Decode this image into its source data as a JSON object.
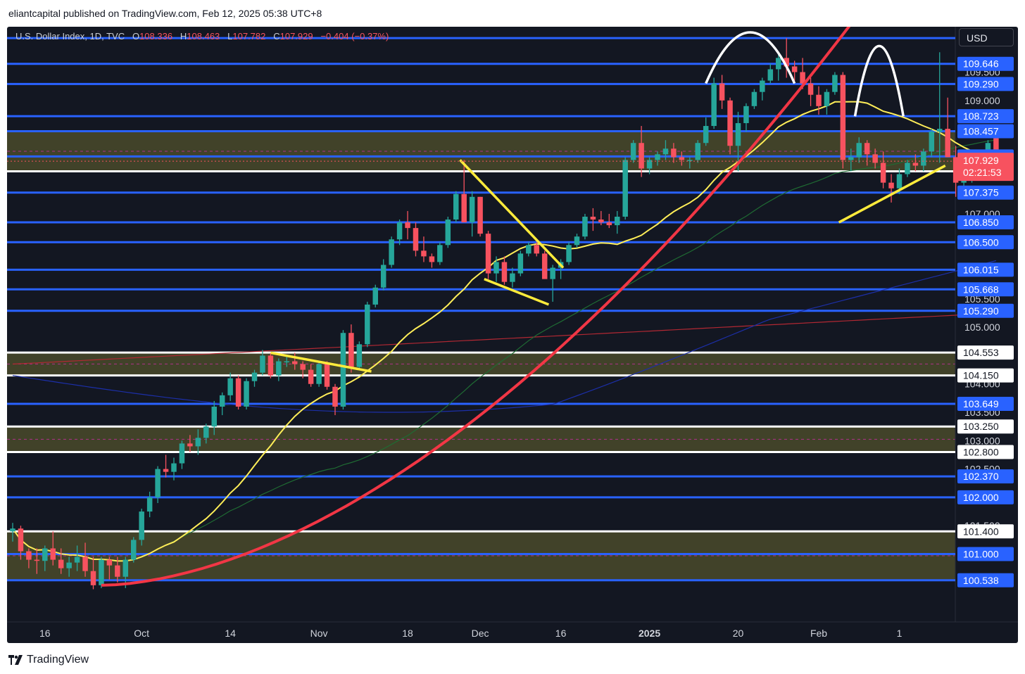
{
  "header": {
    "published_text": "eliantcapital published on TradingView.com, Feb 12, 2025 05:38 UTC+8"
  },
  "legend": {
    "symbol": "U.S. Dollar Index, 1D, TVC",
    "o_label": "O",
    "o_value": "108.336",
    "h_label": "H",
    "h_value": "108.463",
    "l_label": "L",
    "l_value": "107.782",
    "c_label": "C",
    "c_value": "107.929",
    "change": "−0.404 (−0.37%)"
  },
  "currency_button": "USD",
  "footer": {
    "brand": "TradingView"
  },
  "colors": {
    "background": "#131722",
    "up_candle": "#26a69a",
    "down_candle": "#f7525f",
    "level_blue": "#2962ff",
    "level_white": "#ffffff",
    "ma20": "#ffee58",
    "curve": "#f23645",
    "zone_fill": "#4a4a2a"
  },
  "chart_data": {
    "type": "candlestick",
    "symbol": "U.S. Dollar Index",
    "timeframe": "1D",
    "ylim": [
      100.2,
      110.3
    ],
    "x_ticks": [
      "16",
      "Oct",
      "14",
      "Nov",
      "18",
      "Dec",
      "16",
      "2025",
      "20",
      "Feb",
      "1"
    ],
    "y_ticks": [
      "109.500",
      "109.000",
      "107.000",
      "105.500",
      "105.000",
      "104.000",
      "103.500",
      "103.000",
      "102.500",
      "101.500"
    ],
    "tick_values": [
      109.5,
      109.0,
      107.0,
      105.5,
      105.0,
      104.0,
      103.5,
      103.0,
      102.5,
      101.5
    ],
    "x_tick_index": [
      4,
      16,
      27,
      38,
      49,
      58,
      68,
      79,
      90,
      100,
      110
    ],
    "price_levels": [
      {
        "value": 109.646,
        "label": "109.646",
        "color": "blue"
      },
      {
        "value": 109.29,
        "label": "109.290",
        "color": "blue"
      },
      {
        "value": 108.723,
        "label": "108.723",
        "color": "blue"
      },
      {
        "value": 108.457,
        "label": "108.457",
        "color": "blue"
      },
      {
        "value": 108.013,
        "label": "108.013",
        "color": "blue"
      },
      {
        "value": 107.75,
        "label": "107.750",
        "color": "white"
      },
      {
        "value": 107.375,
        "label": "107.375",
        "color": "blue"
      },
      {
        "value": 106.85,
        "label": "106.850",
        "color": "blue"
      },
      {
        "value": 106.5,
        "label": "106.500",
        "color": "blue"
      },
      {
        "value": 106.015,
        "label": "106.015",
        "color": "blue"
      },
      {
        "value": 105.668,
        "label": "105.668",
        "color": "blue"
      },
      {
        "value": 105.29,
        "label": "105.290",
        "color": "blue"
      },
      {
        "value": 104.553,
        "label": "104.553",
        "color": "white"
      },
      {
        "value": 104.15,
        "label": "104.150",
        "color": "white"
      },
      {
        "value": 103.649,
        "label": "103.649",
        "color": "blue"
      },
      {
        "value": 103.25,
        "label": "103.250",
        "color": "white"
      },
      {
        "value": 102.8,
        "label": "102.800",
        "color": "white"
      },
      {
        "value": 102.37,
        "label": "102.370",
        "color": "blue"
      },
      {
        "value": 102.0,
        "label": "102.000",
        "color": "blue"
      },
      {
        "value": 101.4,
        "label": "101.400",
        "color": "white"
      },
      {
        "value": 101.0,
        "label": "101.000",
        "color": "blue"
      },
      {
        "value": 100.538,
        "label": "100.538",
        "color": "blue"
      }
    ],
    "extra_lines": [
      110.1
    ],
    "zones": [
      [
        107.75,
        108.457
      ],
      [
        104.15,
        104.553
      ],
      [
        102.8,
        103.25
      ],
      [
        100.538,
        101.4
      ]
    ],
    "last_price": {
      "value": 107.929,
      "label": "107.929",
      "countdown": "02:21:53"
    },
    "ohlc": [
      [
        101.4,
        101.55,
        101.22,
        101.45
      ],
      [
        101.45,
        101.5,
        100.9,
        101.05
      ],
      [
        101.05,
        101.1,
        100.75,
        100.9
      ],
      [
        100.9,
        101.1,
        100.65,
        100.88
      ],
      [
        100.88,
        101.15,
        100.7,
        101.1
      ],
      [
        101.1,
        101.4,
        100.8,
        100.9
      ],
      [
        100.9,
        101.1,
        100.65,
        100.75
      ],
      [
        100.75,
        100.95,
        100.6,
        100.85
      ],
      [
        100.85,
        101.15,
        100.7,
        100.95
      ],
      [
        100.95,
        101.2,
        100.6,
        100.7
      ],
      [
        100.7,
        100.95,
        100.38,
        100.45
      ],
      [
        100.45,
        100.95,
        100.4,
        100.9
      ],
      [
        100.9,
        100.95,
        100.55,
        100.8
      ],
      [
        100.8,
        100.95,
        100.5,
        100.6
      ],
      [
        100.6,
        100.95,
        100.4,
        100.9
      ],
      [
        100.9,
        101.3,
        100.85,
        101.25
      ],
      [
        101.25,
        101.8,
        101.15,
        101.75
      ],
      [
        101.75,
        102.1,
        101.65,
        102.0
      ],
      [
        102.0,
        102.55,
        101.9,
        102.5
      ],
      [
        102.5,
        102.75,
        102.35,
        102.45
      ],
      [
        102.45,
        102.7,
        102.3,
        102.6
      ],
      [
        102.6,
        103.0,
        102.5,
        102.95
      ],
      [
        102.95,
        103.1,
        102.8,
        102.9
      ],
      [
        102.9,
        103.2,
        102.75,
        103.05
      ],
      [
        103.05,
        103.3,
        102.95,
        103.25
      ],
      [
        103.25,
        103.7,
        103.1,
        103.6
      ],
      [
        103.6,
        103.85,
        103.45,
        103.8
      ],
      [
        103.8,
        104.2,
        103.7,
        104.1
      ],
      [
        104.1,
        104.15,
        103.55,
        103.6
      ],
      [
        103.6,
        104.1,
        103.55,
        104.05
      ],
      [
        104.05,
        104.25,
        103.95,
        104.2
      ],
      [
        104.2,
        104.6,
        104.15,
        104.5
      ],
      [
        104.5,
        104.55,
        104.1,
        104.15
      ],
      [
        104.15,
        104.45,
        104.05,
        104.4
      ],
      [
        104.4,
        104.5,
        104.3,
        104.4
      ],
      [
        104.4,
        104.55,
        104.25,
        104.35
      ],
      [
        104.35,
        104.4,
        104.1,
        104.25
      ],
      [
        104.25,
        104.35,
        103.95,
        104.0
      ],
      [
        104.0,
        104.4,
        103.95,
        104.35
      ],
      [
        104.35,
        104.4,
        103.9,
        103.95
      ],
      [
        103.95,
        104.0,
        103.45,
        103.6
      ],
      [
        103.6,
        104.95,
        103.55,
        104.9
      ],
      [
        104.9,
        105.05,
        104.2,
        104.3
      ],
      [
        104.3,
        104.75,
        104.25,
        104.7
      ],
      [
        104.7,
        105.45,
        104.65,
        105.4
      ],
      [
        105.4,
        105.75,
        105.35,
        105.7
      ],
      [
        105.7,
        106.2,
        105.65,
        106.1
      ],
      [
        106.1,
        106.6,
        106.05,
        106.55
      ],
      [
        106.55,
        106.9,
        106.45,
        106.85
      ],
      [
        106.85,
        107.05,
        106.55,
        106.75
      ],
      [
        106.75,
        106.85,
        106.25,
        106.35
      ],
      [
        106.35,
        106.6,
        106.15,
        106.25
      ],
      [
        106.25,
        106.3,
        106.05,
        106.15
      ],
      [
        106.15,
        106.5,
        106.1,
        106.45
      ],
      [
        106.45,
        106.95,
        106.4,
        106.9
      ],
      [
        106.9,
        107.4,
        106.85,
        107.35
      ],
      [
        107.35,
        107.95,
        107.25,
        106.85
      ],
      [
        106.85,
        107.4,
        106.6,
        107.3
      ],
      [
        107.3,
        107.3,
        106.6,
        106.65
      ],
      [
        106.65,
        106.7,
        105.85,
        105.95
      ],
      [
        105.95,
        106.25,
        105.8,
        106.15
      ],
      [
        106.15,
        106.25,
        105.75,
        105.8
      ],
      [
        105.8,
        106.05,
        105.7,
        105.95
      ],
      [
        105.95,
        106.35,
        105.9,
        106.3
      ],
      [
        106.3,
        106.5,
        106.25,
        106.45
      ],
      [
        106.45,
        106.5,
        106.25,
        106.3
      ],
      [
        106.3,
        106.35,
        105.9,
        105.85
      ],
      [
        105.85,
        106.1,
        105.45,
        106.05
      ],
      [
        106.05,
        106.2,
        105.85,
        106.15
      ],
      [
        106.15,
        106.5,
        106.1,
        106.45
      ],
      [
        106.45,
        106.65,
        106.4,
        106.6
      ],
      [
        106.6,
        107.0,
        106.55,
        106.95
      ],
      [
        106.95,
        107.1,
        106.7,
        106.9
      ],
      [
        106.9,
        107.05,
        106.8,
        106.85
      ],
      [
        106.85,
        107.0,
        106.75,
        106.8
      ],
      [
        106.8,
        107.05,
        106.65,
        106.95
      ],
      [
        106.95,
        108.0,
        106.9,
        107.95
      ],
      [
        107.95,
        108.3,
        107.9,
        108.25
      ],
      [
        108.25,
        108.55,
        107.65,
        107.8
      ],
      [
        107.8,
        108.0,
        107.7,
        107.95
      ],
      [
        107.95,
        108.1,
        107.85,
        108.05
      ],
      [
        108.05,
        108.3,
        107.95,
        108.15
      ],
      [
        108.15,
        108.25,
        107.9,
        108.0
      ],
      [
        108.0,
        108.1,
        107.85,
        107.95
      ],
      [
        107.95,
        108.0,
        107.8,
        107.95
      ],
      [
        107.95,
        108.3,
        107.9,
        108.25
      ],
      [
        108.25,
        108.7,
        108.2,
        108.55
      ],
      [
        108.55,
        109.4,
        108.5,
        109.3
      ],
      [
        109.3,
        109.45,
        108.85,
        109.0
      ],
      [
        109.0,
        109.05,
        108.05,
        108.2
      ],
      [
        108.2,
        108.8,
        107.75,
        108.6
      ],
      [
        108.6,
        108.95,
        108.45,
        108.9
      ],
      [
        108.9,
        109.2,
        108.85,
        109.15
      ],
      [
        109.15,
        109.4,
        109.0,
        109.35
      ],
      [
        109.35,
        109.65,
        109.3,
        109.55
      ],
      [
        109.55,
        109.8,
        109.35,
        109.75
      ],
      [
        109.75,
        110.1,
        109.4,
        109.6
      ],
      [
        109.6,
        109.7,
        109.35,
        109.5
      ],
      [
        109.5,
        109.75,
        109.2,
        109.3
      ],
      [
        109.3,
        109.4,
        108.9,
        109.1
      ],
      [
        109.1,
        109.25,
        108.75,
        108.9
      ],
      [
        108.9,
        109.2,
        108.75,
        109.15
      ],
      [
        109.15,
        109.5,
        109.1,
        109.45
      ],
      [
        109.45,
        109.5,
        107.8,
        107.95
      ],
      [
        107.95,
        108.15,
        107.75,
        108.0
      ],
      [
        108.0,
        108.35,
        107.9,
        108.25
      ],
      [
        108.25,
        108.3,
        107.85,
        108.05
      ],
      [
        108.05,
        108.15,
        107.8,
        107.9
      ],
      [
        107.9,
        108.1,
        107.45,
        107.55
      ],
      [
        107.55,
        107.7,
        107.2,
        107.45
      ],
      [
        107.45,
        107.8,
        107.35,
        107.7
      ],
      [
        107.7,
        107.95,
        107.65,
        107.9
      ],
      [
        107.9,
        108.05,
        107.75,
        107.85
      ],
      [
        107.85,
        108.15,
        107.75,
        108.1
      ],
      [
        108.1,
        108.5,
        108.0,
        108.45
      ],
      [
        108.45,
        109.85,
        107.9,
        108.5
      ],
      [
        108.5,
        109.05,
        108.0,
        108.0
      ],
      [
        108.0,
        108.2,
        107.3,
        107.55
      ],
      [
        107.55,
        107.8,
        107.45,
        107.7
      ],
      [
        107.7,
        107.85,
        107.55,
        107.75
      ],
      [
        107.75,
        108.1,
        107.7,
        108.05
      ],
      [
        108.05,
        108.3,
        107.9,
        108.25
      ],
      [
        108.34,
        108.46,
        107.78,
        107.93
      ]
    ]
  }
}
